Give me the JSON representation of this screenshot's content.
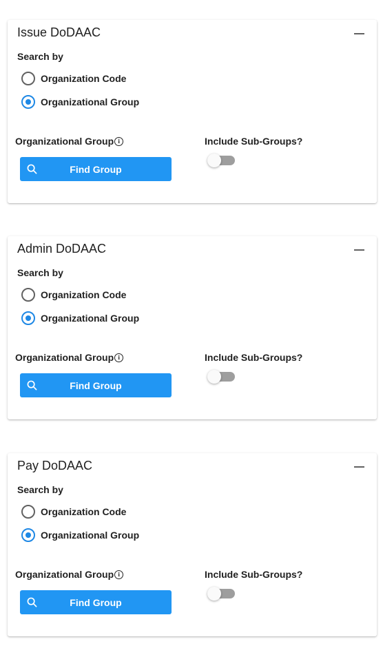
{
  "accent_color": "#2196f3",
  "cards": [
    {
      "title": "Issue DoDAAC",
      "collapse_icon": "minus-icon",
      "search_by_label": "Search by",
      "radio_options": [
        {
          "label": "Organization Code",
          "checked": false
        },
        {
          "label": "Organizational Group",
          "checked": true
        }
      ],
      "group_field_label": "Organizational Group",
      "info_icon": "info-icon",
      "find_button_label": "Find Group",
      "search_icon": "search-icon",
      "subgroups_label": "Include Sub-Groups?",
      "subgroups_enabled": false
    },
    {
      "title": "Admin DoDAAC",
      "collapse_icon": "minus-icon",
      "search_by_label": "Search by",
      "radio_options": [
        {
          "label": "Organization Code",
          "checked": false
        },
        {
          "label": "Organizational Group",
          "checked": true
        }
      ],
      "group_field_label": "Organizational Group",
      "info_icon": "info-icon",
      "find_button_label": "Find Group",
      "search_icon": "search-icon",
      "subgroups_label": "Include Sub-Groups?",
      "subgroups_enabled": false
    },
    {
      "title": "Pay DoDAAC",
      "collapse_icon": "minus-icon",
      "search_by_label": "Search by",
      "radio_options": [
        {
          "label": "Organization Code",
          "checked": false
        },
        {
          "label": "Organizational Group",
          "checked": true
        }
      ],
      "group_field_label": "Organizational Group",
      "info_icon": "info-icon",
      "find_button_label": "Find Group",
      "search_icon": "search-icon",
      "subgroups_label": "Include Sub-Groups?",
      "subgroups_enabled": false
    }
  ]
}
